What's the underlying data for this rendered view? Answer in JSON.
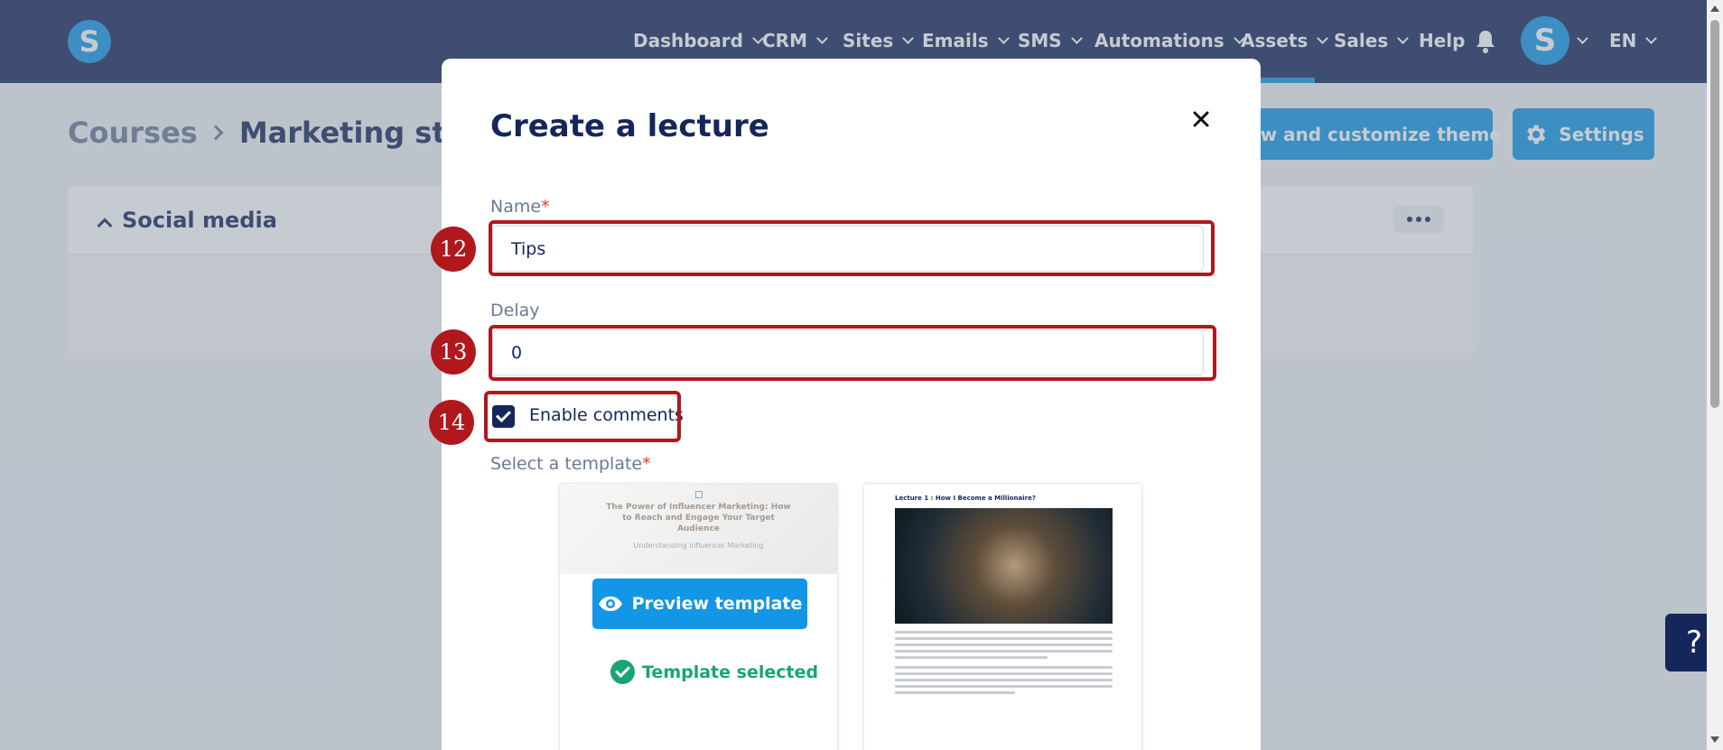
{
  "app": {
    "logo_letter": "S"
  },
  "nav": {
    "items": [
      "Dashboard",
      "CRM",
      "Sites",
      "Emails",
      "SMS",
      "Automations",
      "Assets",
      "Sales",
      "Help"
    ],
    "avatar_letter": "S",
    "language": "EN"
  },
  "page": {
    "breadcrumb": [
      "Courses",
      "Marketing strateg"
    ],
    "customize_theme_label": "View and customize theme",
    "settings_label": "Settings",
    "section_title": "Social media"
  },
  "modal": {
    "title": "Create a lecture",
    "name_label": "Name",
    "name_value": "Tips",
    "delay_label": "Delay",
    "delay_value": "0",
    "enable_comments_label": "Enable comments",
    "enable_comments_checked": true,
    "template_label": "Select a template",
    "required_mark": "*",
    "templates": [
      {
        "thumb_title": "The Power of Influencer Marketing: How to Reach and Engage Your Target Audience",
        "thumb_subtitle": "Understanding Influencer Marketing",
        "preview_label": "Preview template",
        "selected_label": "Template selected"
      },
      {
        "thumb_title": "Lecture 1 : How I Become a Millionaire?"
      }
    ]
  },
  "annotations": [
    "12",
    "13",
    "14"
  ],
  "help_button": "?",
  "colors": {
    "nav_bg": "#15265a",
    "primary": "#1496e6",
    "success": "#17a673",
    "annotation": "#b0181d"
  }
}
